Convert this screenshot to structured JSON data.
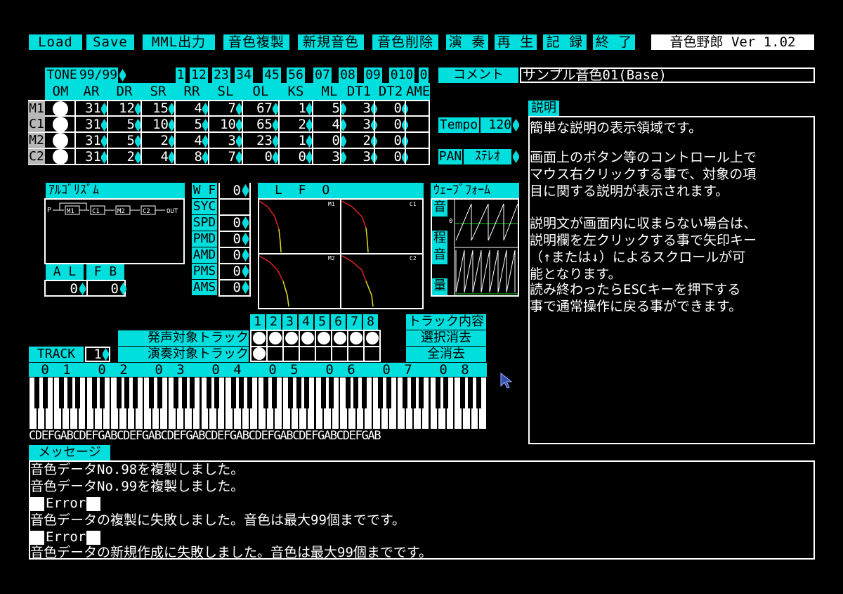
{
  "toolbar": {
    "buttons": [
      "Load",
      "Save",
      "MML出力",
      "音色複製",
      "新規音色",
      "音色削除",
      "演 奏",
      "再 生",
      "記 録",
      "終 了"
    ],
    "app_title": "音色野郎 Ver 1.02"
  },
  "tone": {
    "label": "TONE",
    "value": "99/99",
    "slots": [
      "1",
      "12",
      "23",
      "34",
      "45",
      "56",
      "07",
      "08",
      "09",
      "010",
      "0"
    ]
  },
  "comment": {
    "label": "コメント",
    "value": "サンプル音色01(Base)"
  },
  "op_table": {
    "headers": [
      "OM",
      "AR",
      "DR",
      "SR",
      "RR",
      "SL",
      "OL",
      "KS",
      "ML",
      "DT1",
      "DT2",
      "AME"
    ],
    "rows": [
      {
        "name": "M1",
        "values": [
          "31",
          "12",
          "15",
          "4",
          "7",
          "67",
          "1",
          "5",
          "3",
          "0"
        ]
      },
      {
        "name": "C1",
        "values": [
          "31",
          "5",
          "10",
          "5",
          "10",
          "65",
          "2",
          "4",
          "3",
          "0"
        ]
      },
      {
        "name": "M2",
        "values": [
          "31",
          "5",
          "2",
          "4",
          "3",
          "23",
          "1",
          "0",
          "2",
          "0"
        ]
      },
      {
        "name": "C2",
        "values": [
          "31",
          "2",
          "4",
          "8",
          "7",
          "0",
          "0",
          "3",
          "3",
          "0"
        ]
      }
    ]
  },
  "tempo": {
    "label": "Tempo",
    "value": "120"
  },
  "pan": {
    "label": "PAN",
    "value": "ｽﾃﾚｵ"
  },
  "description": {
    "label": "説明",
    "lines": [
      "簡単な説明の表示領域です。",
      "",
      "画面上のボタン等のコントロール上で",
      "マウス右クリックする事で、対象の項",
      "目に関する説明が表示されます。",
      "",
      "説明文が画面内に収まらない場合は、",
      "説明欄を左クリックする事で矢印キー",
      "（↑または↓）によるスクロールが可",
      "能となります。",
      "読み終わったらESCキーを押下する",
      "事で通常操作に戻る事ができます。"
    ]
  },
  "algorithm": {
    "label": "ｱﾙｺﾞﾘｽﾞﾑ",
    "diagram": [
      "P",
      "M1",
      "C1",
      "M2",
      "C2",
      "OUT"
    ]
  },
  "al_fb": {
    "al_label": "A L",
    "fb_label": "F B",
    "al_value": "0",
    "fb_value": "0"
  },
  "lfo_params": {
    "labels": [
      "W F",
      "SYC",
      "SPD",
      "PMD",
      "AMD",
      "PMS",
      "AMS"
    ],
    "values": [
      "0",
      "",
      "0",
      "0",
      "0",
      "0",
      "0"
    ]
  },
  "lfo": {
    "label": "L F O",
    "panels": [
      "M1",
      "C1",
      "M2",
      "C2"
    ]
  },
  "waveform": {
    "label": "ｳｪｰﾌﾞﾌｫｰﾑ",
    "side_labels": [
      "音",
      "程",
      "音",
      "量"
    ],
    "zero": "0"
  },
  "tracks": {
    "numbers": [
      "1",
      "2",
      "3",
      "4",
      "5",
      "6",
      "7",
      "8"
    ],
    "sound_target_label": "発声対象トラック",
    "play_target_label": "演奏対象トラック",
    "track_label": "TRACK",
    "track_value": "1",
    "buttons": [
      "トラック内容",
      "選択消去",
      "全消去"
    ]
  },
  "octaves": [
    "0 1",
    "0 2",
    "0 3",
    "0 4",
    "0 5",
    "0 6",
    "0 7",
    "0 8"
  ],
  "keys_text": "CDEFGABCDEFGABCDEFGABCDEFGABCDEFGABCDEFGABCDEFGABCDEFGAB",
  "messages": {
    "label": "メッセージ",
    "lines": [
      "音色データNo.98を複製しました。",
      "音色データNo.99を複製しました。",
      "Error",
      "音色データの複製に失敗しました。音色は最大99個までです。",
      "Error",
      "音色データの新規作成に失敗しました。音色は最大99個までです。"
    ]
  },
  "colors": {
    "accent": "#00dede",
    "background": "#000000",
    "text": "#ffffff"
  }
}
